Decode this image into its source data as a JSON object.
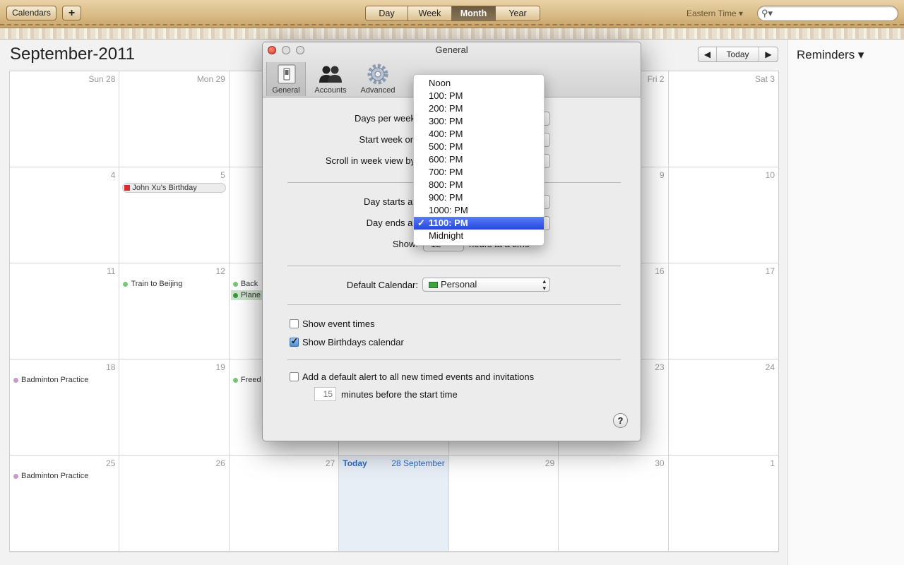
{
  "toolbar": {
    "calendars_label": "Calendars",
    "add_label": "+",
    "views": [
      "Day",
      "Week",
      "Month",
      "Year"
    ],
    "active_view": "Month",
    "timezone_label": "Eastern Time",
    "search_placeholder": "",
    "search_icon": "magnifier-icon"
  },
  "calendar": {
    "title": "September-2011",
    "nav_prev": "◀",
    "nav_today": "Today",
    "nav_next": "▶",
    "weeks": [
      [
        {
          "label": "Sun 28"
        },
        {
          "label": "Mon 29"
        },
        {
          "label": ""
        },
        {
          "label": ""
        },
        {
          "label": ""
        },
        {
          "label": "Fri 2"
        },
        {
          "label": "Sat 3"
        }
      ],
      [
        {
          "label": "4"
        },
        {
          "label": "5",
          "events": [
            {
              "text": "John Xu's Birthday",
              "kind": "birthday"
            }
          ]
        },
        {
          "label": ""
        },
        {
          "label": ""
        },
        {
          "label": ""
        },
        {
          "label": "9"
        },
        {
          "label": "10"
        }
      ],
      [
        {
          "label": "11"
        },
        {
          "label": "12",
          "events": [
            {
              "text": "Train to Beijing",
              "color": "#7cc47c"
            }
          ]
        },
        {
          "label": "",
          "events": [
            {
              "text": "Back",
              "color": "#7cc47c"
            },
            {
              "text": "Plane",
              "color": "#3d9a3d",
              "kind": "sel"
            }
          ]
        },
        {
          "label": ""
        },
        {
          "label": ""
        },
        {
          "label": "16"
        },
        {
          "label": "17"
        }
      ],
      [
        {
          "label": "18",
          "events": [
            {
              "text": "Badminton Practice",
              "color": "#c79ac7"
            }
          ]
        },
        {
          "label": "19"
        },
        {
          "label": "",
          "events": [
            {
              "text": "Freed",
              "color": "#7cc47c"
            }
          ]
        },
        {
          "label": ""
        },
        {
          "label": ""
        },
        {
          "label": "23"
        },
        {
          "label": "24"
        }
      ],
      [
        {
          "label": "25",
          "events": [
            {
              "text": "Badminton Practice",
              "color": "#c79ac7"
            }
          ]
        },
        {
          "label": "26"
        },
        {
          "label": "27"
        },
        {
          "label": "28 September",
          "today": "Today"
        },
        {
          "label": "29"
        },
        {
          "label": "30"
        },
        {
          "label": "1"
        }
      ]
    ]
  },
  "reminders": {
    "title": "Reminders ▾"
  },
  "prefs": {
    "title": "General",
    "tabs": [
      {
        "label": "General",
        "icon": "switch-icon"
      },
      {
        "label": "Accounts",
        "icon": "users-icon"
      },
      {
        "label": "Advanced",
        "icon": "gear-icon"
      }
    ],
    "days_per_week_label": "Days per week",
    "start_week_label": "Start week on",
    "scroll_label": "Scroll in week view by",
    "day_starts_label": "Day starts at",
    "day_ends_label": "Day ends at",
    "show_label": "Show:",
    "show_value": "12",
    "hours_label": "hours at a time",
    "default_calendar_label": "Default Calendar:",
    "default_calendar_value": "Personal",
    "default_calendar_color": "#3ea53e",
    "show_event_times_label": "Show event times",
    "show_event_times_checked": false,
    "show_birthdays_label": "Show Birthdays calendar",
    "show_birthdays_checked": true,
    "default_alert_label": "Add a default alert to all new timed events and invitations",
    "default_alert_checked": false,
    "alert_minutes_value": "15",
    "alert_minutes_label": "minutes before the start time",
    "help_label": "?"
  },
  "dropdown": {
    "options": [
      "Noon",
      "100: PM",
      "200: PM",
      "300: PM",
      "400: PM",
      "500: PM",
      "600: PM",
      "700: PM",
      "800: PM",
      "900: PM",
      "1000: PM",
      "1100: PM",
      "Midnight"
    ],
    "selected": "1100: PM"
  }
}
